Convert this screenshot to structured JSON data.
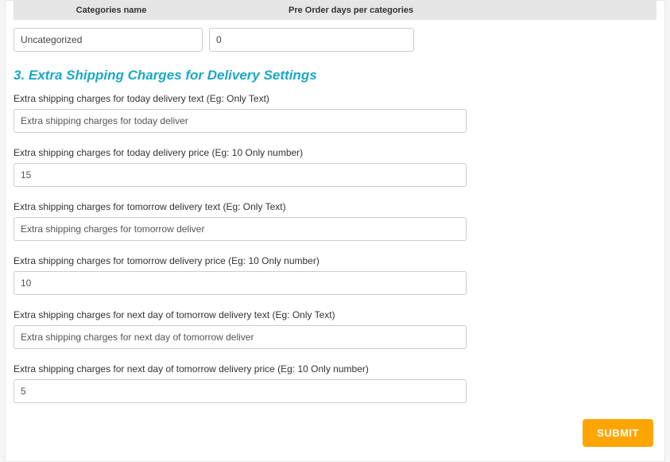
{
  "table": {
    "headers": {
      "categories_name": "Categories name",
      "preorder_days": "Pre Order days per categories"
    },
    "row": {
      "category": "Uncategorized",
      "days": "0"
    }
  },
  "section": {
    "title": "3. Extra Shipping Charges for Delivery Settings"
  },
  "fields": {
    "today_text": {
      "label": "Extra shipping charges for today delivery text (Eg: Only Text)",
      "value": "Extra shipping charges for today deliver"
    },
    "today_price": {
      "label": "Extra shipping charges for today delivery price (Eg: 10 Only number)",
      "value": "15"
    },
    "tomorrow_text": {
      "label": "Extra shipping charges for tomorrow delivery text (Eg: Only Text)",
      "value": "Extra shipping charges for tomorrow deliver"
    },
    "tomorrow_price": {
      "label": "Extra shipping charges for tomorrow delivery price (Eg: 10 Only number)",
      "value": "10"
    },
    "nextday_text": {
      "label": "Extra shipping charges for next day of tomorrow delivery text (Eg: Only Text)",
      "value": "Extra shipping charges for next day of tomorrow deliver"
    },
    "nextday_price": {
      "label": "Extra shipping charges for next day of tomorrow delivery price (Eg: 10 Only number)",
      "value": "5"
    }
  },
  "buttons": {
    "submit": "SUBMIT"
  }
}
